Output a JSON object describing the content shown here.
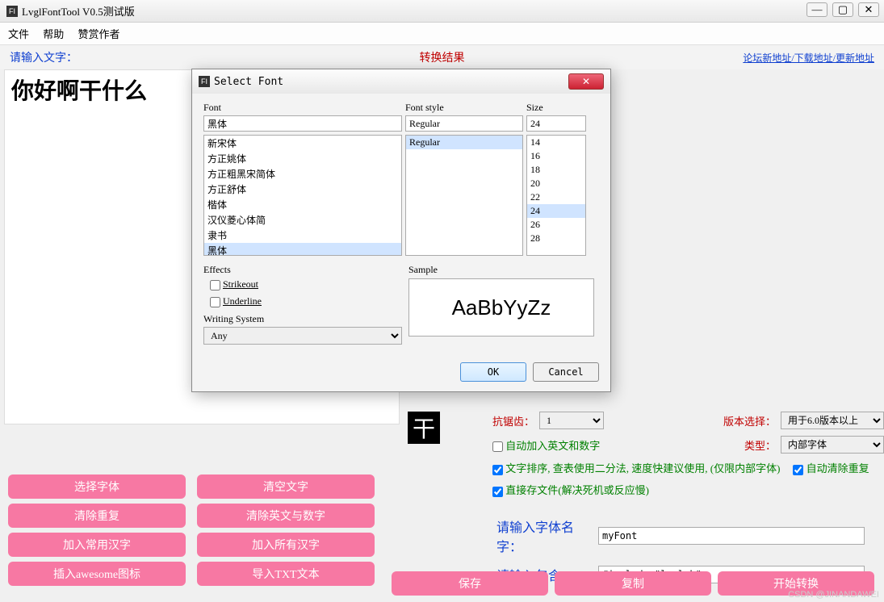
{
  "window": {
    "title": "LvglFontTool V0.5测试版",
    "icon": "FI"
  },
  "menu": {
    "file": "文件",
    "help": "帮助",
    "sponsor": "赞赏作者"
  },
  "topbar": {
    "input_label": "请输入文字：",
    "result_label": "转换结果",
    "links": "论坛新地址/下载地址/更新地址"
  },
  "input_text": "你好啊干什么",
  "preview_glyph": "干",
  "settings": {
    "antialias_label": "抗锯齿：",
    "antialias_value": "1",
    "version_label": "版本选择：",
    "version_value": "用于6.0版本以上",
    "type_label": "类型：",
    "type_value": "内部字体",
    "auto_latin": "自动加入英文和数字",
    "binary_sort": "文字排序, 查表使用二分法, 速度快建议使用, (仅限内部字体)",
    "auto_dedup": "自动清除重复",
    "direct_save": "直接存文件(解决死机或反应慢)",
    "font_name_label": "请输入字体名字：",
    "font_name_value": "myFont",
    "include_label": "请输入包含：",
    "include_value": "#include \"lvgl.h\""
  },
  "buttons": {
    "select_font": "选择字体",
    "clear_text": "清空文字",
    "dedup": "清除重复",
    "clear_latin": "清除英文与数字",
    "common_hanzi": "加入常用汉字",
    "all_hanzi": "加入所有汉字",
    "awesome": "插入awesome图标",
    "import_txt": "导入TXT文本",
    "save": "保存",
    "copy": "复制",
    "convert": "开始转换"
  },
  "dialog": {
    "title": "Select Font",
    "icon": "FI",
    "font_label": "Font",
    "style_label": "Font style",
    "size_label": "Size",
    "font_value": "黑体",
    "style_value": "Regular",
    "size_value": "24",
    "fonts": [
      "新宋体",
      "方正姚体",
      "方正粗黑宋简体",
      "方正舒体",
      "楷体",
      "汉仪菱心体简",
      "隶书",
      "黑体"
    ],
    "font_selected": "黑体",
    "styles": [
      "Regular"
    ],
    "style_selected": "Regular",
    "sizes": [
      "14",
      "16",
      "18",
      "20",
      "22",
      "24",
      "26",
      "28"
    ],
    "size_selected": "24",
    "effects_label": "Effects",
    "strikeout": "Strikeout",
    "underline": "Underline",
    "wsys_label": "Writing System",
    "wsys_value": "Any",
    "sample_label": "Sample",
    "sample_text": "AaBbYyZz",
    "ok": "OK",
    "cancel": "Cancel"
  },
  "watermark": "CSDN @JINANDAWEI"
}
